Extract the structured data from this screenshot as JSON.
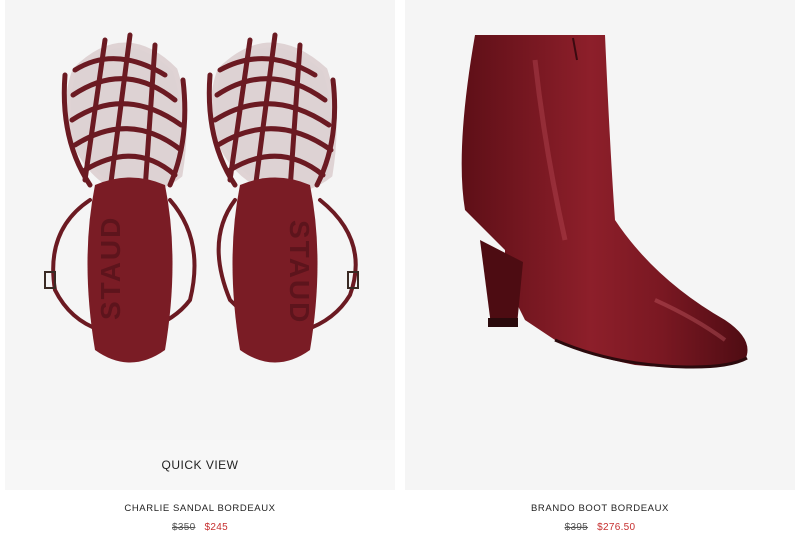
{
  "colors": {
    "image_background": "#f5f5f5",
    "quickview_background": "#f7f7f7",
    "shoe_leather": "#6a1a22",
    "sale_price": "#c62f2f"
  },
  "products": [
    {
      "image_alt": "strappy burgundy sandals, top view",
      "quick_view_label": "QUICK VIEW",
      "name": "CHARLIE SANDAL BORDEAUX",
      "original_price": "$350",
      "sale_price": "$245",
      "sole_print": "STAUD"
    },
    {
      "image_alt": "burgundy patent ankle boot, side view",
      "name": "BRANDO BOOT BORDEAUX",
      "original_price": "$395",
      "sale_price": "$276.50"
    }
  ]
}
